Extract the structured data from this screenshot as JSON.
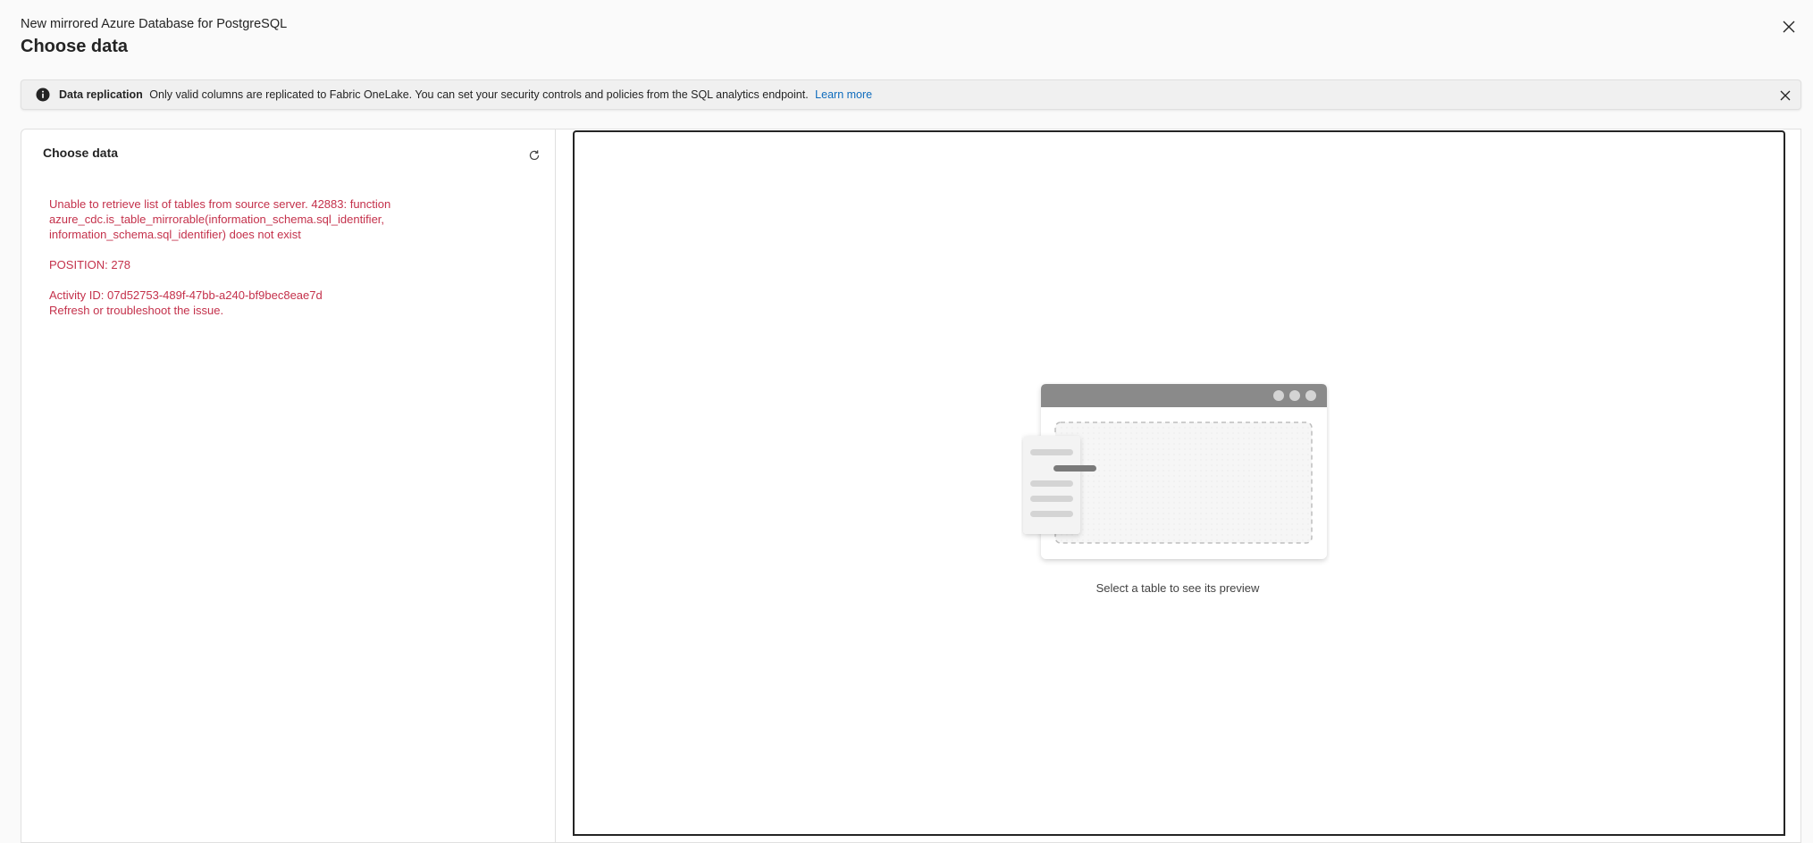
{
  "header": {
    "subtitle": "New mirrored Azure Database for PostgreSQL",
    "title": "Choose data"
  },
  "banner": {
    "title": "Data replication",
    "message": "Only valid columns are replicated to Fabric OneLake. You can set your security controls and policies from the SQL analytics endpoint.",
    "link": "Learn more",
    "icon": "info-icon"
  },
  "left_panel": {
    "title": "Choose data",
    "error": {
      "message": "Unable to retrieve list of tables from source server. 42883: function azure_cdc.is_table_mirrorable(information_schema.sql_identifier, information_schema.sql_identifier) does not exist",
      "position": "POSITION: 278",
      "activity": "Activity ID: 07d52753-489f-47bb-a240-bf9bec8eae7d",
      "hint": "Refresh or troubleshoot the issue."
    }
  },
  "preview": {
    "caption": "Select a table to see its preview"
  },
  "colors": {
    "error": "#c4314b",
    "link": "#0f6cbd",
    "illustration_bar": "#8a8a8a"
  }
}
